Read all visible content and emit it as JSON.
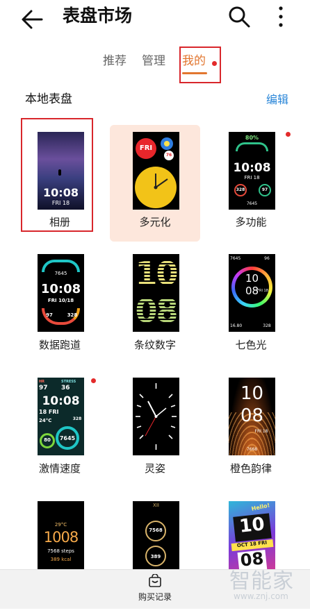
{
  "header": {
    "title": "表盘市场"
  },
  "tabs": [
    {
      "label": "推荐"
    },
    {
      "label": "管理"
    },
    {
      "label": "我的"
    }
  ],
  "section": {
    "title": "本地表盘",
    "edit_label": "编辑"
  },
  "faces": [
    {
      "name": "相册",
      "text": {
        "time": "10:08",
        "date": "FRI 18"
      }
    },
    {
      "name": "多元化",
      "text": {
        "day": "FRI",
        "num": "76"
      }
    },
    {
      "name": "多功能",
      "text": {
        "battery": "80%",
        "time": "10:08",
        "date": "FRI 18",
        "a": "328",
        "b": "97",
        "steps": "7645"
      }
    },
    {
      "name": "数据跑道",
      "text": {
        "steps": "7645",
        "time": "10:08",
        "date": "FRI   10/18",
        "a": "97",
        "b": "328"
      }
    },
    {
      "name": "条纹数字",
      "text": {
        "hh": "10",
        "mm": "08"
      }
    },
    {
      "name": "七色光",
      "text": {
        "tl": "7645",
        "tr": "96",
        "hh": "10",
        "mm": "08",
        "day": "FRI 18",
        "bl": "16.80",
        "br": "328"
      }
    },
    {
      "name": "激情速度",
      "text": {
        "hr": "HR",
        "stress": "STRESS",
        "v1": "97",
        "v2": "36",
        "time": "10:08",
        "date": "18 FRI",
        "temp": "24°C",
        "c1": "80",
        "c2": "7645",
        "c3": "328"
      }
    },
    {
      "name": "灵姿",
      "text": {}
    },
    {
      "name": "橙色韵律",
      "text": {
        "hh": "10",
        "mm": "08",
        "date": "FRI 18",
        "steps": "7668"
      }
    },
    {
      "name": "",
      "text": {
        "temp": "29°C",
        "time": "1008",
        "steps": "7568 steps",
        "kcal": "389 kcal"
      }
    },
    {
      "name": "",
      "text": {
        "top": "XII",
        "steps": "7568",
        "kcal": "389"
      }
    },
    {
      "name": "",
      "text": {
        "hello": "Hello!",
        "hh": "10",
        "date": "OCT 18 FRI",
        "mm": "08"
      }
    }
  ],
  "bottom": {
    "purchase_label": "购买记录"
  },
  "watermark": {
    "logo": "智能家",
    "url": "www.znj.com"
  },
  "colors": {
    "accent": "#e2762f",
    "link": "#2a86d8",
    "dot": "#e32b2b",
    "highlight": "#fde7dc"
  }
}
